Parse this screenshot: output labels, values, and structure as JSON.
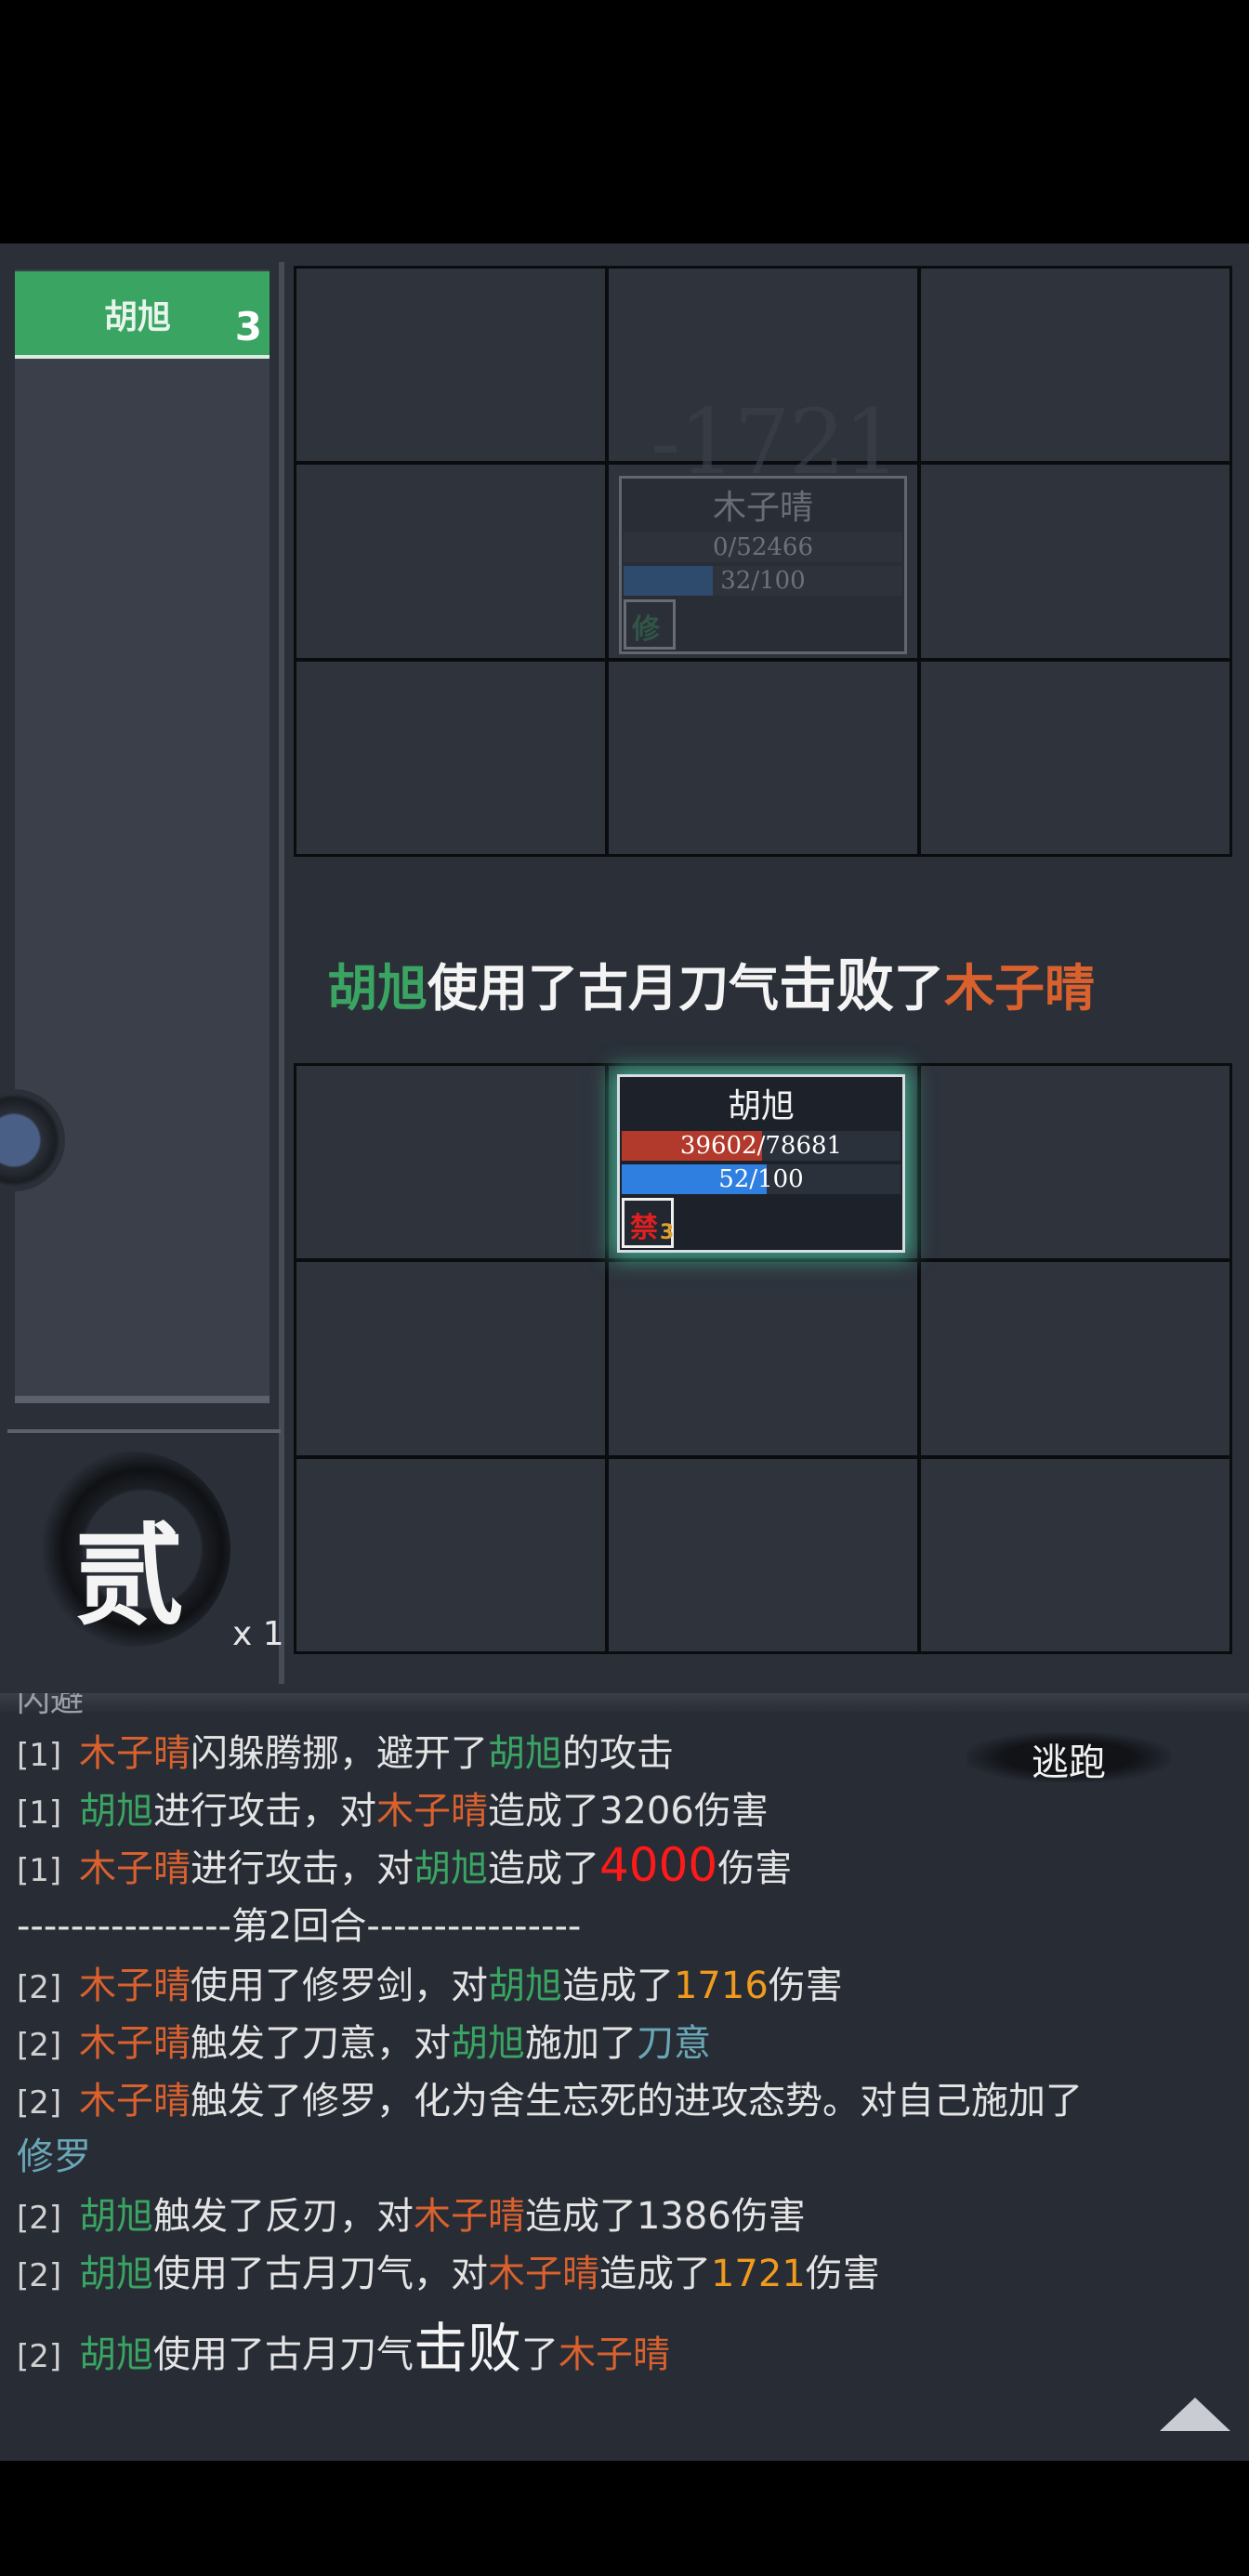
{
  "player_tag": {
    "name": "胡旭",
    "count": "3"
  },
  "round": {
    "char": "贰",
    "count": "x 1"
  },
  "enemy_unit": {
    "name": "木子晴",
    "hp_text": "0/52466",
    "hp_frac": 0.0,
    "mp_text": "32/100",
    "mp_frac": 0.32,
    "status": "修",
    "status_color": "#3aa462"
  },
  "ally_unit": {
    "name": "胡旭",
    "hp_text": "39602/78681",
    "hp_frac": 0.503,
    "mp_text": "52/100",
    "mp_frac": 0.52,
    "status": "禁",
    "status_count": "3",
    "status_color": "#e02020"
  },
  "damage_float": "-1721",
  "announce": {
    "actor": "胡旭",
    "pre": "使用了古月刀气",
    "verb": "击败",
    "mid": "了",
    "target": "木子晴"
  },
  "escape_label": "逃跑",
  "log": {
    "partial_top": "闪避",
    "lines": [
      [
        {
          "t": "[1] ",
          "c": "tag"
        },
        {
          "t": "木子晴",
          "c": "c-orange"
        },
        {
          "t": "闪躲腾挪，避开了",
          "c": ""
        },
        {
          "t": "胡旭",
          "c": "c-green"
        },
        {
          "t": "的攻击",
          "c": ""
        }
      ],
      [
        {
          "t": "[1] ",
          "c": "tag"
        },
        {
          "t": "胡旭",
          "c": "c-green"
        },
        {
          "t": "进行攻击，对",
          "c": ""
        },
        {
          "t": "木子晴",
          "c": "c-orange"
        },
        {
          "t": "造成了3206伤害",
          "c": ""
        }
      ],
      [
        {
          "t": "[1] ",
          "c": "tag"
        },
        {
          "t": "木子晴",
          "c": "c-orange"
        },
        {
          "t": "进行攻击，对",
          "c": ""
        },
        {
          "t": "胡旭",
          "c": "c-green"
        },
        {
          "t": "造成了",
          "c": ""
        },
        {
          "t": "4000",
          "c": "c-red big"
        },
        {
          "t": "伤害",
          "c": ""
        }
      ],
      [
        {
          "t": "----------------第2回合----------------",
          "c": ""
        }
      ],
      [
        {
          "t": "[2] ",
          "c": "tag"
        },
        {
          "t": "木子晴",
          "c": "c-orange"
        },
        {
          "t": "使用了修罗剑，对",
          "c": ""
        },
        {
          "t": "胡旭",
          "c": "c-green"
        },
        {
          "t": "造成了",
          "c": ""
        },
        {
          "t": "1716",
          "c": "c-yellow"
        },
        {
          "t": "伤害",
          "c": ""
        }
      ],
      [
        {
          "t": "[2] ",
          "c": "tag"
        },
        {
          "t": "木子晴",
          "c": "c-orange"
        },
        {
          "t": "触发了刀意，对",
          "c": ""
        },
        {
          "t": "胡旭",
          "c": "c-green"
        },
        {
          "t": "施加了",
          "c": ""
        },
        {
          "t": "刀意",
          "c": "c-cyan"
        }
      ],
      [
        {
          "t": "[2] ",
          "c": "tag"
        },
        {
          "t": "木子晴",
          "c": "c-orange"
        },
        {
          "t": "触发了修罗，化为舍生忘死的进攻态势。对自己施加了",
          "c": ""
        }
      ],
      [
        {
          "t": "修罗",
          "c": "c-cyan"
        }
      ],
      [
        {
          "t": "[2] ",
          "c": "tag"
        },
        {
          "t": "胡旭",
          "c": "c-green"
        },
        {
          "t": "触发了反刃，对",
          "c": ""
        },
        {
          "t": "木子晴",
          "c": "c-orange"
        },
        {
          "t": "造成了1386伤害",
          "c": ""
        }
      ],
      [
        {
          "t": "[2] ",
          "c": "tag"
        },
        {
          "t": "胡旭",
          "c": "c-green"
        },
        {
          "t": "使用了古月刀气，对",
          "c": ""
        },
        {
          "t": "木子晴",
          "c": "c-orange"
        },
        {
          "t": "造成了",
          "c": ""
        },
        {
          "t": "1721",
          "c": "c-yellow"
        },
        {
          "t": "伤害",
          "c": ""
        }
      ],
      [
        {
          "t": "[2] ",
          "c": "tag"
        },
        {
          "t": "胡旭",
          "c": "c-green"
        },
        {
          "t": "使用了古月刀气",
          "c": ""
        },
        {
          "t": "击败",
          "c": "bigwhite"
        },
        {
          "t": "了",
          "c": ""
        },
        {
          "t": "木子晴",
          "c": "c-orange"
        }
      ]
    ]
  }
}
